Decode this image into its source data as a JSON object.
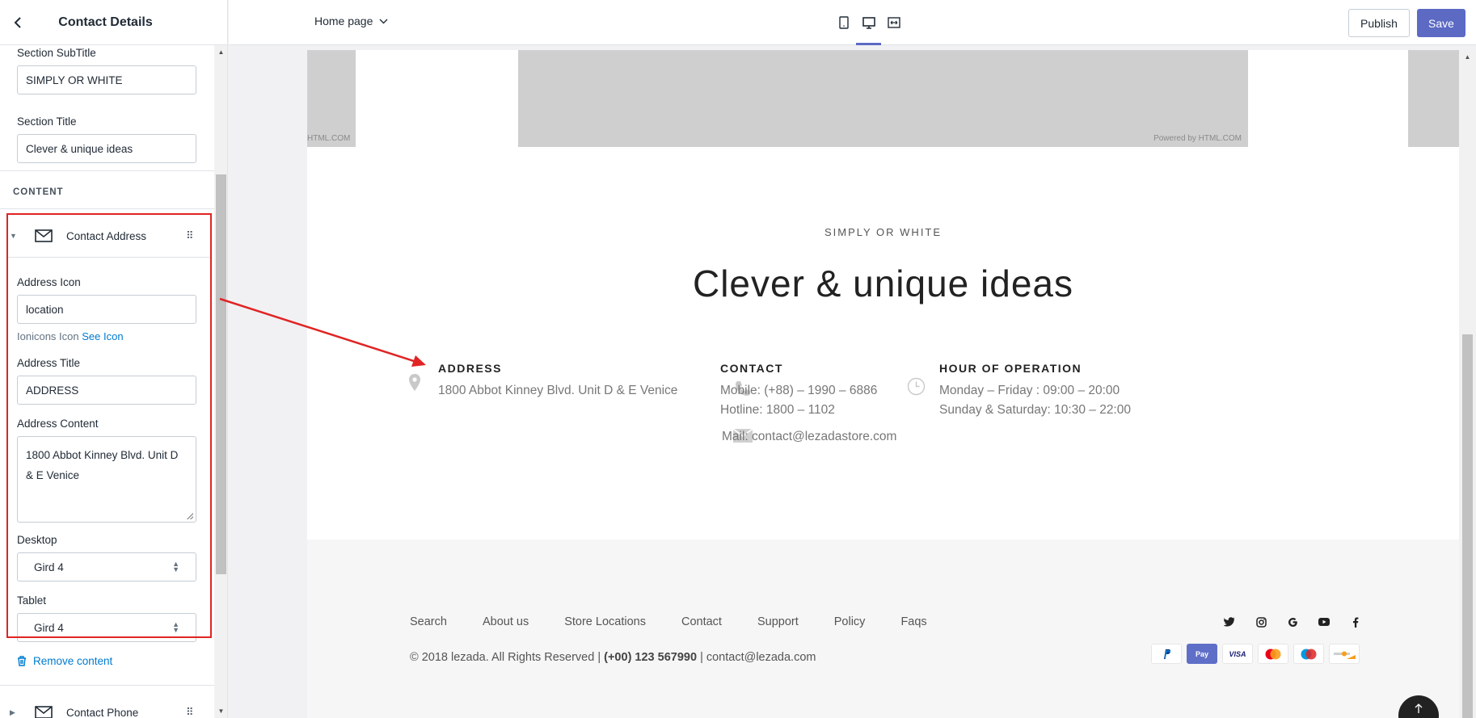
{
  "sidebar": {
    "title": "Contact Details",
    "section_subtitle_label": "Section SubTitle",
    "section_subtitle_value": "SIMPLY OR WHITE",
    "section_title_label": "Section Title",
    "section_title_value": "Clever & unique ideas",
    "content_heading": "CONTENT",
    "items": [
      {
        "label": "Contact Address",
        "icon": "envelope-icon",
        "expanded": true
      },
      {
        "label": "Contact Phone",
        "icon": "envelope-icon",
        "expanded": false
      }
    ],
    "address_icon_label": "Address Icon",
    "address_icon_value": "location",
    "icon_hint": "Ionicons Icon",
    "icon_hint_link": "See Icon",
    "address_title_label": "Address Title",
    "address_title_value": "ADDRESS",
    "address_content_label": "Address Content",
    "address_content_line1": "1800 Abbot Kinney Blvd. Unit D",
    "address_content_line2": "& E Venice",
    "desktop_label": "Desktop",
    "desktop_value": "Gird 4",
    "tablet_label": "Tablet",
    "tablet_value": "Gird 4",
    "remove_label": "Remove content"
  },
  "topbar": {
    "page_select": "Home page",
    "devices": [
      "mobile-icon",
      "desktop-icon",
      "fullwidth-icon"
    ],
    "active_device": "desktop-icon",
    "publish_label": "Publish",
    "save_label": "Save",
    "accent_color": "#5c6ac4"
  },
  "preview": {
    "map_credit_left": "HTML.COM",
    "map_credit_right": "Powered by HTML.COM",
    "subtitle": "SIMPLY OR WHITE",
    "title": "Clever & unique ideas",
    "address": {
      "heading": "ADDRESS",
      "line": "1800 Abbot Kinney Blvd. Unit D & E Venice",
      "icon": "location-pin-icon"
    },
    "contact": {
      "heading": "CONTACT",
      "mobile": "Mobile: (+88) – 1990 – 6886",
      "hotline": "Hotline: 1800 – 1102",
      "mail": "Mail: contact@lezadastore.com",
      "icon": "phone-icon",
      "mail_icon": "mail-icon"
    },
    "hours": {
      "heading": "HOUR OF OPERATION",
      "weekdays": "Monday – Friday : 09:00 – 20:00",
      "weekend": "Sunday & Saturday: 10:30 – 22:00",
      "icon": "clock-icon"
    },
    "footer": {
      "nav": [
        "Search",
        "About us",
        "Store Locations",
        "Contact",
        "Support",
        "Policy",
        "Faqs"
      ],
      "copyright_pre": "© 2018 lezada. All Rights Reserved |",
      "copyright_phone": "(+00) 123 567990",
      "copyright_post": "| contact@lezada.com",
      "socials": [
        "twitter-icon",
        "instagram-icon",
        "google-icon",
        "youtube-icon",
        "facebook-icon"
      ],
      "payments": [
        "PayPal",
        "Apple Pay",
        "VISA",
        "Mastercard",
        "Maestro",
        "Discover"
      ],
      "pay_labels": {
        "applepay": "Pay",
        "visa": "VISA"
      }
    }
  }
}
